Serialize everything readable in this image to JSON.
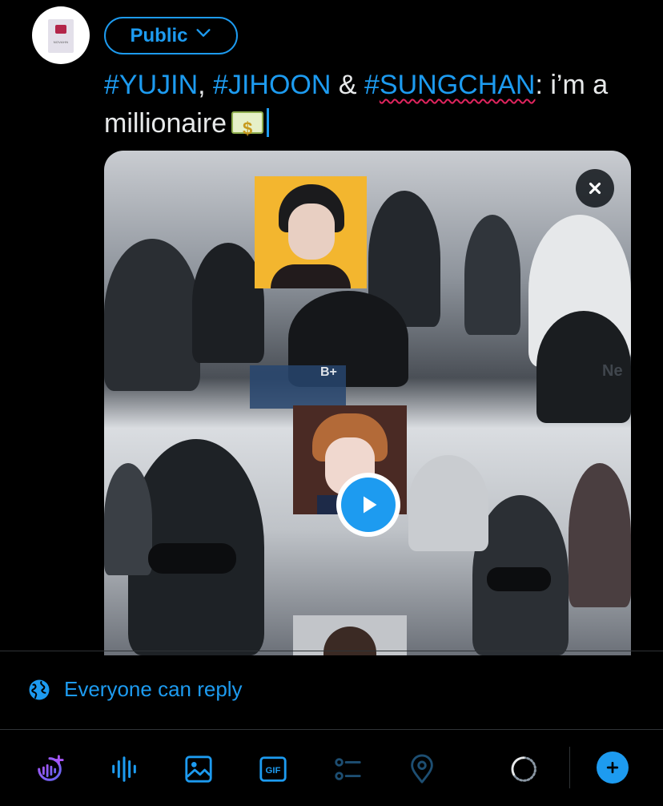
{
  "audience": {
    "label": "Public"
  },
  "avatar": {
    "caption": "NOVAHN"
  },
  "compose": {
    "tag1": "#YUJIN",
    "sep1": ", ",
    "tag2": "#JIHOON",
    "sep2": " & ",
    "tag3_prefix": "#",
    "tag3_word": "SUNGCHAN",
    "rest": ": i’m a millionaire"
  },
  "media": {
    "type": "video",
    "sign_text": "Ne",
    "sign_board": "B+"
  },
  "reply": {
    "label": "Everyone can reply"
  },
  "toolbar": {
    "icons": [
      "spaces-icon",
      "voice-icon",
      "image-icon",
      "gif-icon",
      "poll-icon",
      "location-icon",
      "char-counter",
      "add-thread-icon"
    ],
    "gif_label": "GIF"
  },
  "colors": {
    "accent": "#1d9bf0",
    "background": "#000000",
    "text": "#e7e9ea",
    "divider": "#2f3336",
    "spaces_purple": "#8b5cf6"
  }
}
